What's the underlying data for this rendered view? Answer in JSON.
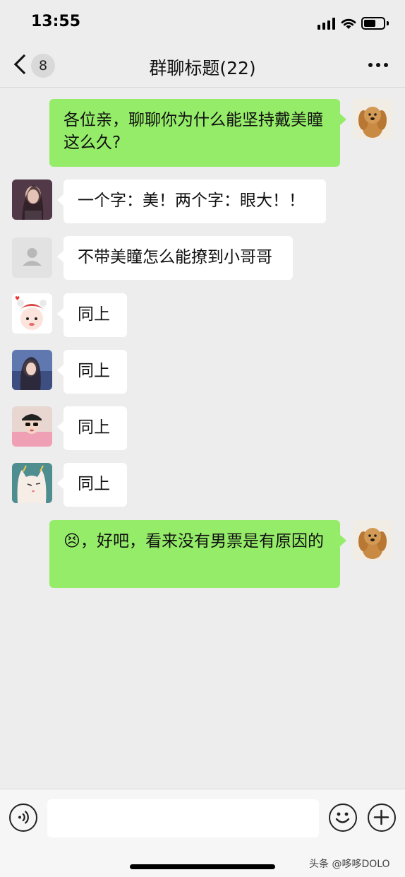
{
  "status_bar": {
    "time": "13:55"
  },
  "nav": {
    "badge": "8",
    "title": "群聊标题(22)"
  },
  "messages": [
    {
      "side": "out",
      "text": "各位亲，聊聊你为什么能坚持戴美瞳这么久?",
      "avatar": "dog-avatar"
    },
    {
      "side": "in",
      "text": "一个字：美！两个字：眼大！！",
      "avatar": "woman-avatar"
    },
    {
      "side": "in",
      "text": "不带美瞳怎么能撩到小哥哥",
      "avatar": "default-avatar"
    },
    {
      "side": "in",
      "text": "同上",
      "avatar": "cartoon-girl-avatar"
    },
    {
      "side": "in",
      "text": "同上",
      "avatar": "photo-girl-avatar"
    },
    {
      "side": "in",
      "text": "同上",
      "avatar": "cap-girl-avatar"
    },
    {
      "side": "in",
      "text": "同上",
      "avatar": "cat-avatar"
    },
    {
      "side": "out",
      "emoji": "😣",
      "text": "，好吧，看来没有男票是有原因的",
      "avatar": "dog-avatar"
    }
  ],
  "input_bar": {
    "placeholder": ""
  },
  "watermark": "头条 @哆哆DOLO",
  "colors": {
    "outgoing_bubble": "#95ec69",
    "incoming_bubble": "#ffffff",
    "background": "#ededed"
  }
}
